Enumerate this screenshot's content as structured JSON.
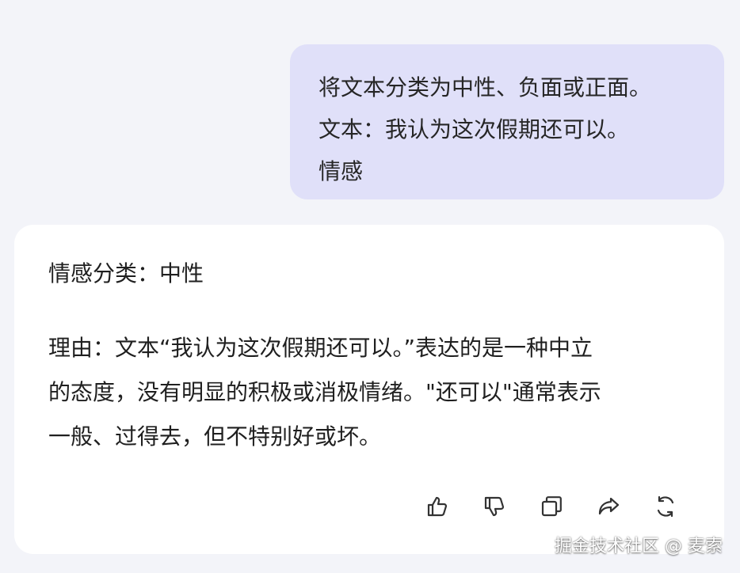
{
  "user_message": {
    "lines": [
      "将文本分类为中性、负面或正面。",
      "文本：我认为这次假期还可以。",
      "情感"
    ]
  },
  "assistant_message": {
    "classification": "情感分类：中性",
    "reason_lines": [
      "理由：文本“我认为这次假期还可以。”表达的是一种中立",
      "的态度，没有明显的积极或消极情绪。\"还可以\"通常表示",
      "一般、过得去，但不特别好或坏。"
    ]
  },
  "actions": [
    {
      "name": "like",
      "icon": "thumbs-up-icon"
    },
    {
      "name": "dislike",
      "icon": "thumbs-down-icon"
    },
    {
      "name": "copy",
      "icon": "copy-icon"
    },
    {
      "name": "share",
      "icon": "share-icon"
    },
    {
      "name": "regenerate",
      "icon": "refresh-icon"
    }
  ],
  "watermark": "掘金技术社区 @ 麦索",
  "colors": {
    "background": "#f3f4f9",
    "user_bubble": "#e0e0f9",
    "assistant_card": "#ffffff"
  }
}
